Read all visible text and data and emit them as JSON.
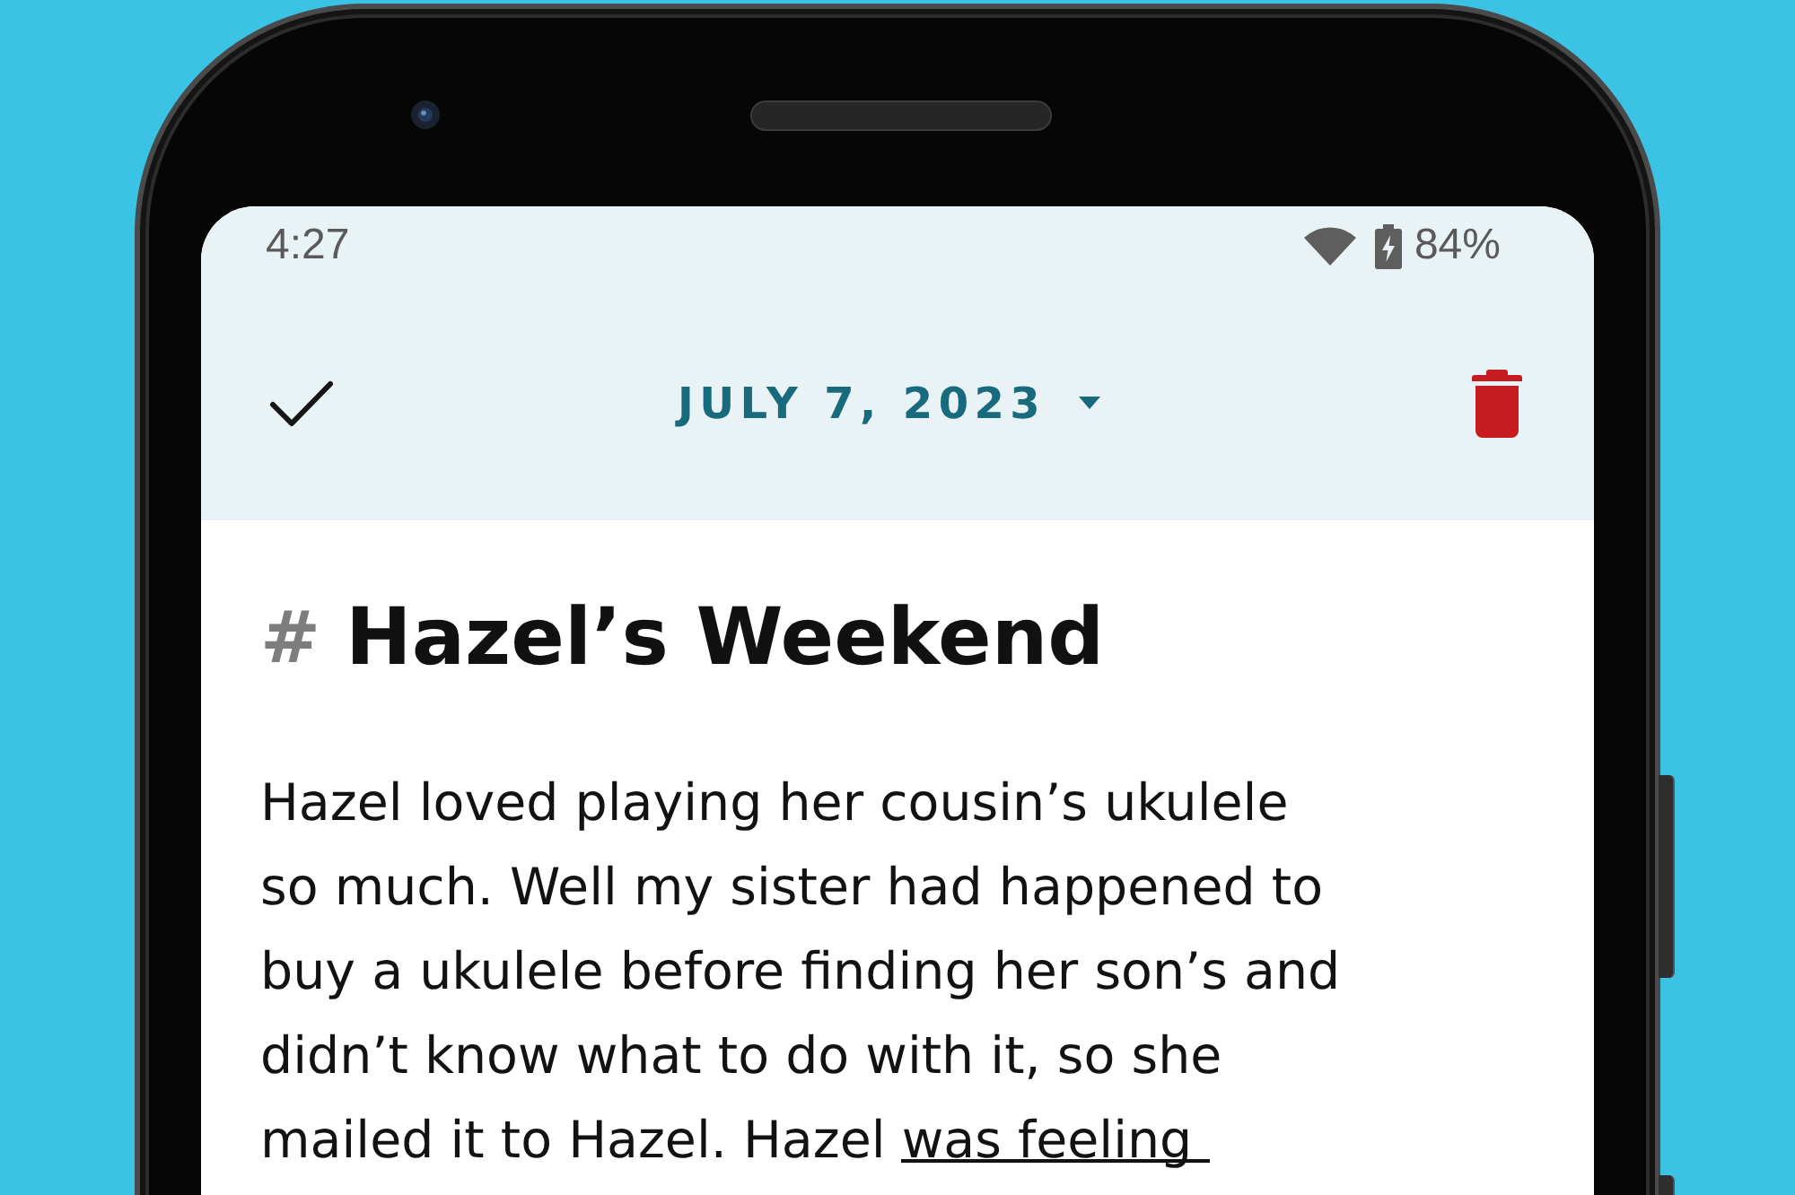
{
  "status_bar": {
    "time": "4:27",
    "battery": "84%"
  },
  "toolbar": {
    "date": "JULY 7, 2023"
  },
  "note": {
    "heading_marker": "#",
    "title": "Hazel’s Weekend",
    "body_lines": [
      {
        "segments": [
          {
            "text": "Hazel loved playing her cousin’s ukulele",
            "underlined": false
          }
        ]
      },
      {
        "segments": [
          {
            "text": "so much. Well my sister had happened to",
            "underlined": false
          }
        ]
      },
      {
        "segments": [
          {
            "text": "buy a ukulele before finding her son’s and",
            "underlined": false
          }
        ]
      },
      {
        "segments": [
          {
            "text": "didn’t know what to do with it, so she",
            "underlined": false
          }
        ]
      },
      {
        "segments": [
          {
            "text": "mailed it to Hazel. Hazel ",
            "underlined": false
          },
          {
            "text": "was feeling",
            "underlined": true
          }
        ]
      }
    ]
  }
}
